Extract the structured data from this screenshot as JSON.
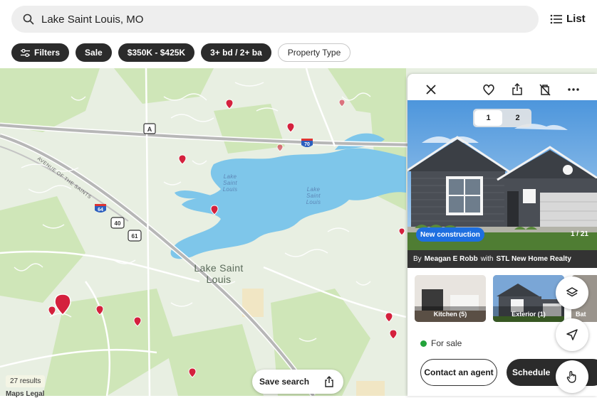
{
  "search": {
    "value": "Lake Saint Louis, MO"
  },
  "header": {
    "list_label": "List"
  },
  "filters": {
    "filters_label": "Filters",
    "sale_label": "Sale",
    "price_label": "$350K - $425K",
    "beds_label": "3+ bd / 2+ ba",
    "property_type_label": "Property Type"
  },
  "map": {
    "city_label": "Lake Saint Louis",
    "lake_label_1": "Lake Saint Louis",
    "lake_label_2": "Lake Saint Louis",
    "road_label": "AVENUE OF THE SAINTS",
    "shield_a": "A",
    "shield_70": "70",
    "shield_64": "64",
    "shield_40": "40",
    "shield_61": "61",
    "results": "27 results",
    "maps_logo": "Maps  Legal",
    "save_search_label": "Save search"
  },
  "listing": {
    "pager": [
      "1",
      "2"
    ],
    "badge": "New construction",
    "photo_counter": "1 / 21",
    "byline_prefix": "By",
    "agent": "Meagan E Robb",
    "byline_with": "with",
    "brokerage": "STL New Home Realty",
    "thumbnails": [
      "Kitchen (5)",
      "Exterior (1)",
      "Bat"
    ],
    "status": "For sale",
    "contact_label": "Contact an agent",
    "schedule_label": "Schedule"
  },
  "colors": {
    "accent_blue": "#1e6fe0",
    "pin_red": "#d4213d",
    "status_green": "#22a33a",
    "water": "#7ec6ea"
  }
}
